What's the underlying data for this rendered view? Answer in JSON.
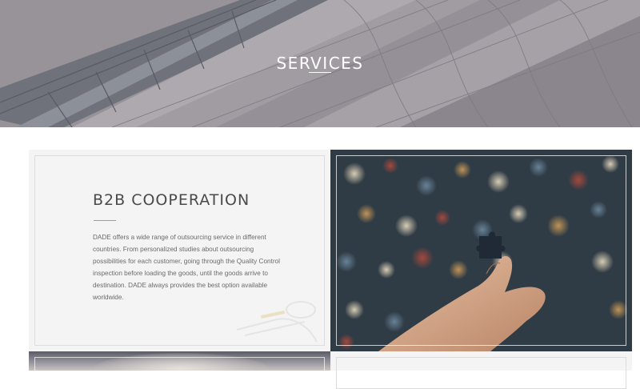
{
  "hero": {
    "title": "SERVICES"
  },
  "services": [
    {
      "title": "B2B COOPERATION",
      "body": "DADE offers a wide range of outsourcing service in different countries. From personalized studies about outsourcing possibilities for each customer, going through the Quality Control inspection before loading the goods, until the goods arrive to destination. DADE always provides the best option available worldwide.",
      "image": "hand-holding-puzzle-piece-photo"
    }
  ],
  "colors": {
    "accent": "#7fa99b",
    "card_background": "#f4f4f4",
    "heading_text": "#4a4a4a",
    "body_text": "#6a6a6a"
  }
}
